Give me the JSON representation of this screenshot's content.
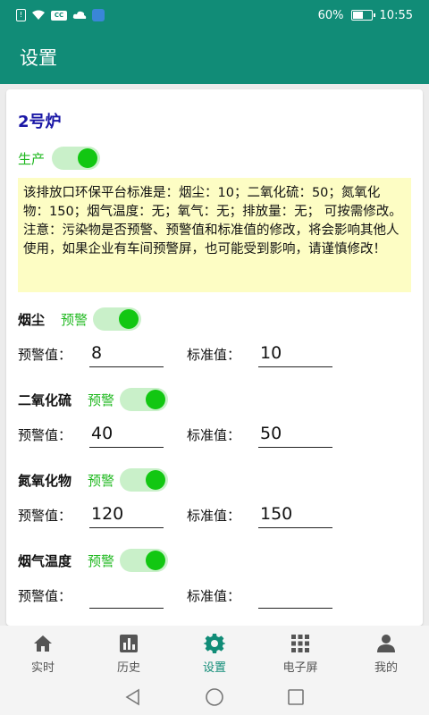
{
  "status_bar": {
    "battery_percent": "60%",
    "time": "10:55",
    "battery_level": 0.6
  },
  "app_bar": {
    "title": "设置"
  },
  "card": {
    "title": "2号炉",
    "production": {
      "label": "生产",
      "enabled": true
    },
    "notice": {
      "line1": "该排放口环保平台标准是：烟尘：10；二氧化硫：50；氮氧化物：150；烟气温度：无；氧气：无；排放量：无； 可按需修改。",
      "line2": "注意：污染物是否预警、预警值和标准值的修改，将会影响其他人使用，如果企业有车间预警屏，也可能受到影响，请谨慎修改！"
    },
    "pollutants": [
      {
        "name": "烟尘",
        "warn_label": "预警",
        "warn_enabled": true,
        "warn_value_label": "预警值：",
        "warn_value": "8",
        "std_value_label": "标准值：",
        "std_value": "10"
      },
      {
        "name": "二氧化硫",
        "warn_label": "预警",
        "warn_enabled": true,
        "warn_value_label": "预警值：",
        "warn_value": "40",
        "std_value_label": "标准值：",
        "std_value": "50"
      },
      {
        "name": "氮氧化物",
        "warn_label": "预警",
        "warn_enabled": true,
        "warn_value_label": "预警值：",
        "warn_value": "120",
        "std_value_label": "标准值：",
        "std_value": "150"
      },
      {
        "name": "烟气温度",
        "warn_label": "预警",
        "warn_enabled": true,
        "warn_value_label": "预警值：",
        "warn_value": "",
        "std_value_label": "标准值：",
        "std_value": ""
      }
    ]
  },
  "bottom_nav": {
    "items": [
      {
        "label": "实时",
        "icon": "home-icon"
      },
      {
        "label": "历史",
        "icon": "bar-chart-icon"
      },
      {
        "label": "设置",
        "icon": "gear-icon",
        "active": true
      },
      {
        "label": "电子屏",
        "icon": "grid-icon"
      },
      {
        "label": "我的",
        "icon": "person-icon"
      }
    ]
  },
  "colors": {
    "primary": "#118c77",
    "title_blue": "#1a17a6",
    "label_green": "#1fb81f",
    "toggle_knob": "#12c712",
    "notice_bg": "#fdfdc4"
  }
}
